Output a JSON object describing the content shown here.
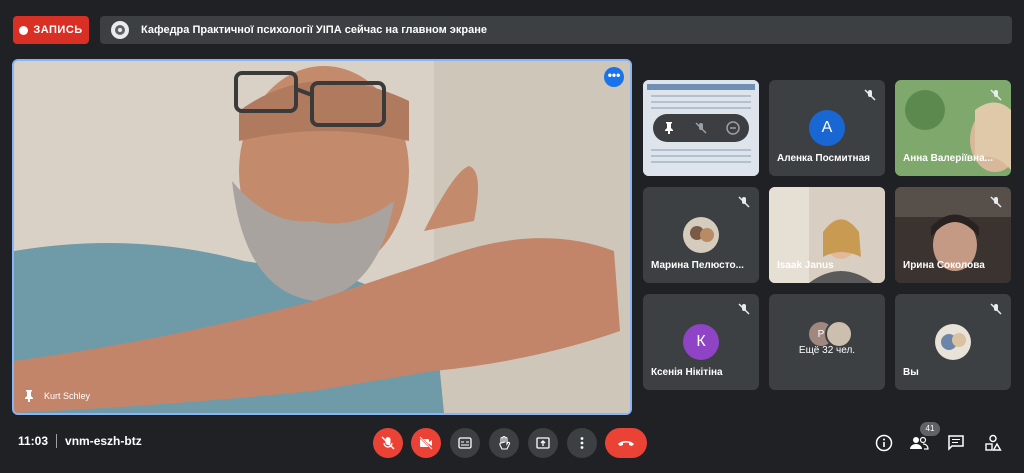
{
  "recording": {
    "label": "ЗАПИСЬ",
    "color": "#d93025"
  },
  "banner": {
    "text": "Кафедра Практичної психології УІПА сейчас на главном экране",
    "avatar_icon": "presenter-avatar"
  },
  "main_video": {
    "participant_name": "Kurt Schley",
    "more_icon": "more-options-icon",
    "pinned": true
  },
  "tiles": [
    {
      "name": "",
      "type": "screen",
      "muted": true,
      "pin_controls": [
        "pin-icon",
        "mute-off-icon",
        "remove-icon"
      ]
    },
    {
      "name": "Аленка Посмитная",
      "type": "letter",
      "letter": "А",
      "avatar_color": "#1967d2",
      "muted": true
    },
    {
      "name": "Анна Валеріївна...",
      "type": "video",
      "muted": true
    },
    {
      "name": "Марина Пелюсто...",
      "type": "photo-avatar",
      "muted": true
    },
    {
      "name": "Isaak Janus",
      "type": "video",
      "muted": false
    },
    {
      "name": "Ирина Соколова",
      "type": "video",
      "muted": true
    },
    {
      "name": "Ксенія Нікітіна",
      "type": "letter",
      "letter": "К",
      "avatar_color": "#8e44c4",
      "muted": true
    },
    {
      "name": "",
      "type": "more",
      "more_text": "Ещё 32 чел.",
      "mini_letter": "Р",
      "muted": false
    },
    {
      "name": "Вы",
      "type": "photo-avatar",
      "muted": true
    }
  ],
  "bottom": {
    "time": "11:03",
    "meeting_code": "vnm-eszh-btz",
    "participants_count": "41",
    "controls": [
      "mic-off-icon",
      "camera-off-icon",
      "captions-icon",
      "raise-hand-icon",
      "present-icon",
      "more-vert-icon",
      "hangup-icon"
    ],
    "right_controls": [
      "info-icon",
      "people-icon",
      "chat-icon",
      "activities-icon"
    ]
  }
}
